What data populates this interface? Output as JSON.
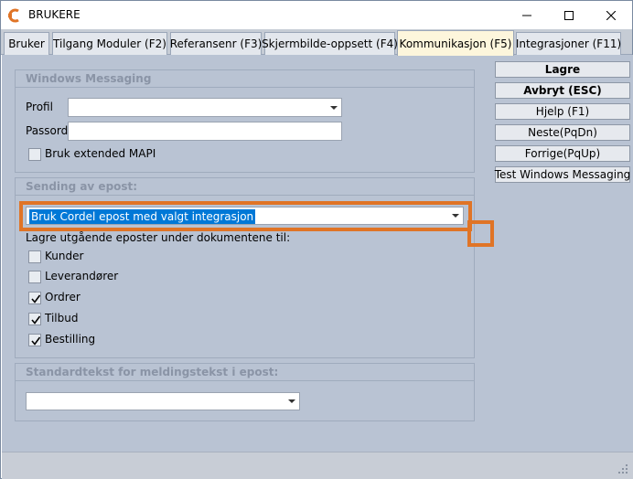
{
  "window": {
    "title": "BRUKERE",
    "colors": {
      "content_bg": "#b9c3d3",
      "active_tab": "#fdf6dc",
      "highlight": "#e07426",
      "selection": "#0078d7"
    }
  },
  "tabs": [
    {
      "label": "Bruker",
      "active": false
    },
    {
      "label": "Tilgang Moduler (F2)",
      "active": false
    },
    {
      "label": "Referansenr (F3)",
      "active": false
    },
    {
      "label": "Skjermbilde-oppsett (F4)",
      "active": false
    },
    {
      "label": "Kommunikasjon (F5)",
      "active": true
    },
    {
      "label": "Integrasjoner (F11)",
      "active": false
    }
  ],
  "windows_messaging": {
    "title": "Windows Messaging",
    "profil_label": "Profil",
    "profil_value": "",
    "passord_label": "Passord",
    "passord_value": "",
    "extended_mapi_label": "Bruk extended MAPI",
    "extended_mapi_checked": false
  },
  "sending": {
    "title": "Sending av epost:",
    "method_value": "Bruk Cordel epost med valgt integrasjon",
    "save_label": "Lagre utgående eposter under dokumentene til:",
    "options": [
      {
        "label": "Kunder",
        "checked": false
      },
      {
        "label": "Leverandører",
        "checked": false
      },
      {
        "label": "Ordrer",
        "checked": true
      },
      {
        "label": "Tilbud",
        "checked": true
      },
      {
        "label": "Bestilling",
        "checked": true
      }
    ]
  },
  "standardtekst": {
    "title": "Standardtekst for meldingstekst i epost:",
    "value": ""
  },
  "buttons": {
    "lagre": "Lagre",
    "avbryt": "Avbryt (ESC)",
    "hjelp": "Hjelp (F1)",
    "neste": "Neste(PqDn)",
    "forrige": "Forrige(PqUp)",
    "test": "Test Windows Messaging"
  }
}
